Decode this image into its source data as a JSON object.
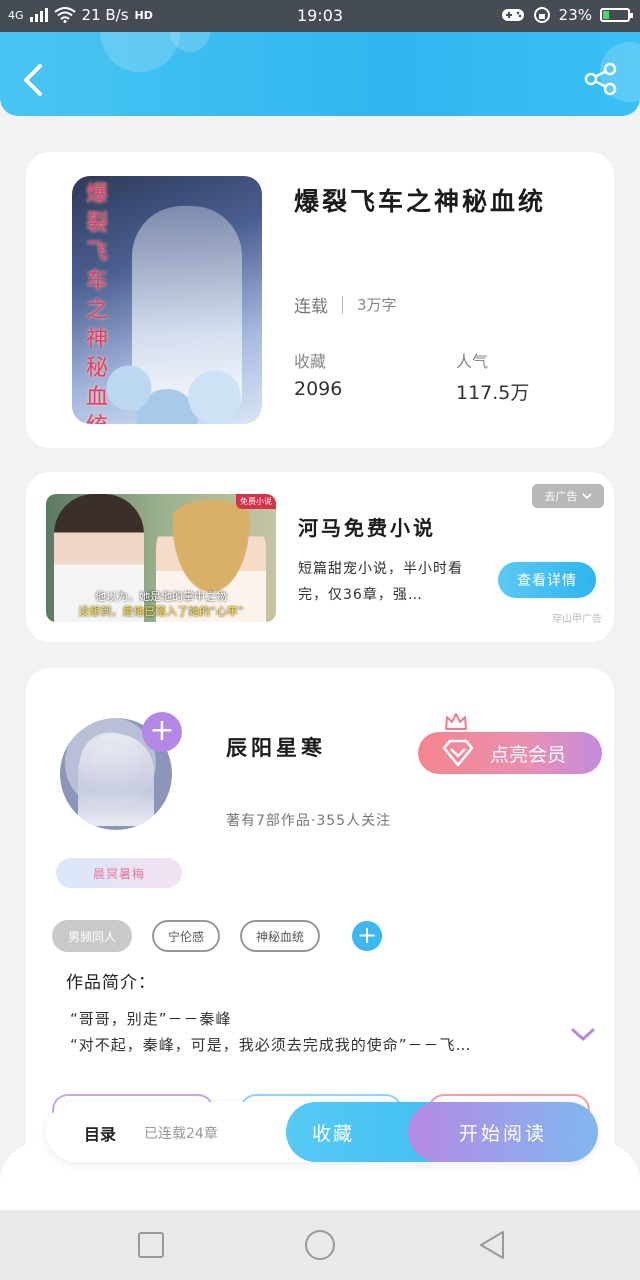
{
  "status_bar": {
    "network": "4G",
    "speed": "21 B/s",
    "hd": "HD",
    "time": "19:03",
    "battery": "23%",
    "battery_level": 0.23
  },
  "book": {
    "cover_title": "爆裂飞车之神秘血统",
    "title": "爆裂飞车之神秘血统",
    "status": "连载",
    "word_count": "3万字",
    "favorites_label": "收藏",
    "favorites_value": "2096",
    "popularity_label": "人气",
    "popularity_value": "117.5万"
  },
  "ad": {
    "title": "河马免费小说",
    "description": "短篇甜宠小说，半小时看完，仅36章，强…",
    "close_label": "去广告",
    "button_label": "查看详情",
    "source": "穿山甲广告",
    "subtitle_line1": "他以为，她是他的掌中之物",
    "subtitle_line2": "没想到，是他已落入了她的“心牢”",
    "corner_tag": "免费小说"
  },
  "author": {
    "name": "辰阳星寒",
    "stats": "著有7部作品·355人关注",
    "vip_label": "点亮会员",
    "badge": "晨冥暑梅",
    "follow_symbol": "+",
    "tags": [
      "男频同人",
      "宁伦感",
      "神秘血统"
    ],
    "tag_add_symbol": "+",
    "intro_label": "作品简介：",
    "intro_lines": [
      "“哥哥，别走”－－秦峰",
      "“对不起，秦峰，可是，我必须去完成我的使命”－－飞…"
    ]
  },
  "bottom_bar": {
    "toc_label": "目录",
    "toc_progress": "已连载24章",
    "collect_label": "收藏",
    "read_label": "开始阅读"
  },
  "colors": {
    "header": "#30b6ef",
    "accent_purple": "#b487e6",
    "accent_blue": "#3cb7f0",
    "vip_pink": "#f4858e"
  },
  "icons": [
    "back-arrow-icon",
    "share-icon",
    "crown-icon",
    "diamond-icon",
    "plus-icon",
    "chevron-down-icon",
    "wifi-icon",
    "battery-icon"
  ]
}
